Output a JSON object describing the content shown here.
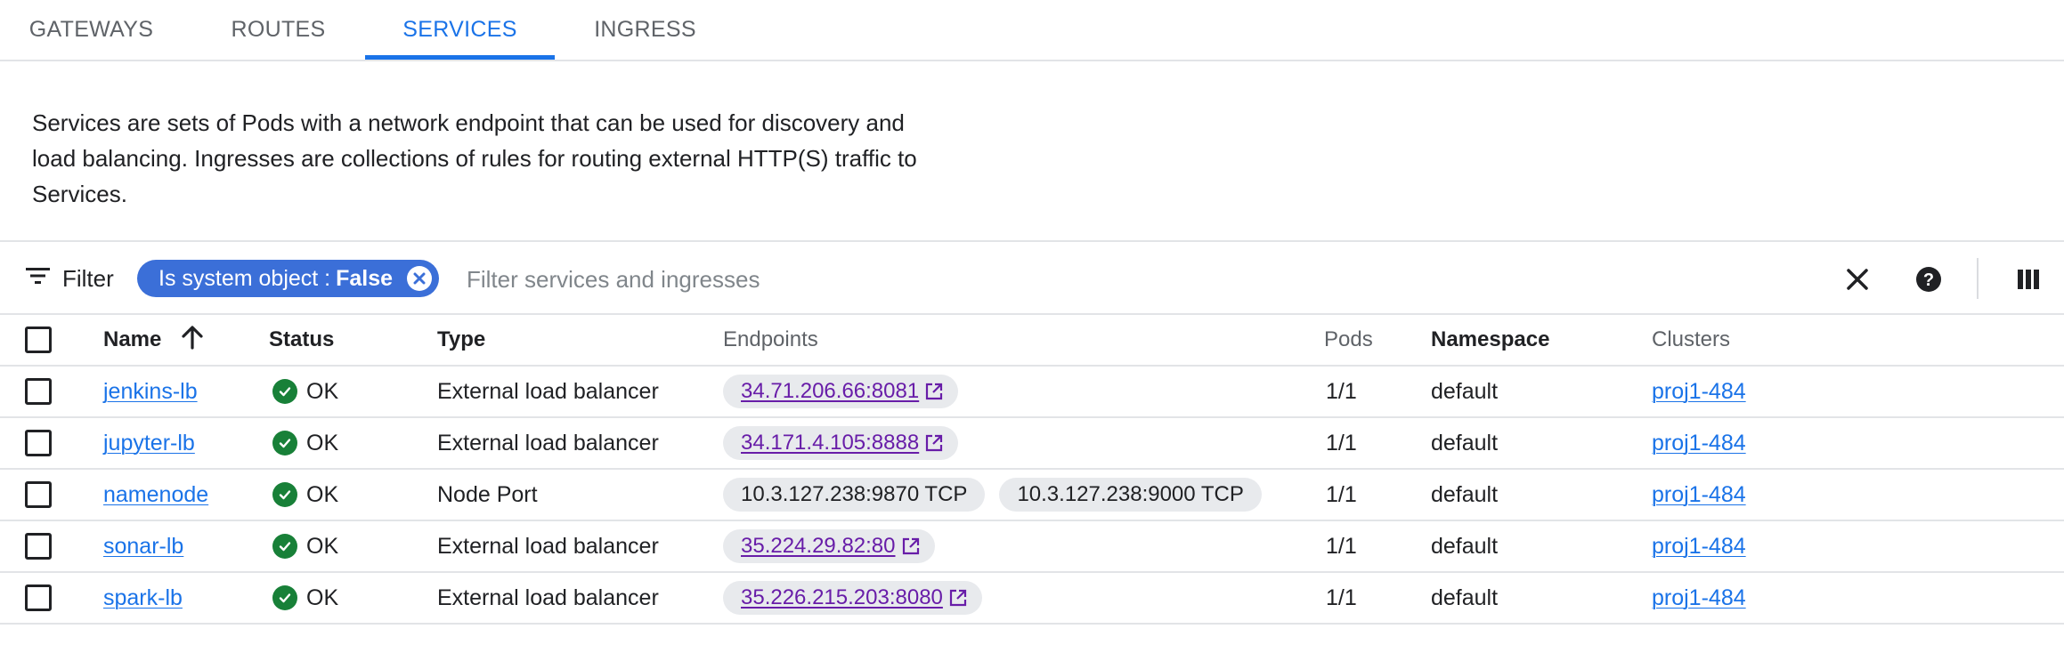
{
  "tabs": [
    {
      "label": "GATEWAYS",
      "active": false
    },
    {
      "label": "ROUTES",
      "active": false
    },
    {
      "label": "SERVICES",
      "active": true
    },
    {
      "label": "INGRESS",
      "active": false
    }
  ],
  "description": "Services are sets of Pods with a network endpoint that can be used for discovery and load balancing. Ingresses are collections of rules for routing external HTTP(S) traffic to Services.",
  "filter": {
    "button_label": "Filter",
    "chip": {
      "key": "Is system object :",
      "value": "False"
    },
    "placeholder": "Filter services and ingresses",
    "icons": [
      "filter-icon",
      "close-icon",
      "help-icon",
      "column-display-icon"
    ]
  },
  "table": {
    "columns": {
      "name": "Name",
      "status": "Status",
      "type": "Type",
      "endpoints": "Endpoints",
      "pods": "Pods",
      "namespace": "Namespace",
      "clusters": "Clusters"
    },
    "sort": {
      "column": "Name",
      "direction": "ascending"
    },
    "rows": [
      {
        "name": "jenkins-lb",
        "status": "OK",
        "type": "External load balancer",
        "endpoints": [
          {
            "text": "34.71.206.66:8081",
            "link": true
          }
        ],
        "pods": "1/1",
        "namespace": "default",
        "cluster": "proj1-484"
      },
      {
        "name": "jupyter-lb",
        "status": "OK",
        "type": "External load balancer",
        "endpoints": [
          {
            "text": "34.171.4.105:8888",
            "link": true
          }
        ],
        "pods": "1/1",
        "namespace": "default",
        "cluster": "proj1-484"
      },
      {
        "name": "namenode",
        "status": "OK",
        "type": "Node Port",
        "endpoints": [
          {
            "text": "10.3.127.238:9870 TCP",
            "link": false
          },
          {
            "text": "10.3.127.238:9000 TCP",
            "link": false
          }
        ],
        "pods": "1/1",
        "namespace": "default",
        "cluster": "proj1-484"
      },
      {
        "name": "sonar-lb",
        "status": "OK",
        "type": "External load balancer",
        "endpoints": [
          {
            "text": "35.224.29.82:80",
            "link": true
          }
        ],
        "pods": "1/1",
        "namespace": "default",
        "cluster": "proj1-484"
      },
      {
        "name": "spark-lb",
        "status": "OK",
        "type": "External load balancer",
        "endpoints": [
          {
            "text": "35.226.215.203:8080",
            "link": true
          }
        ],
        "pods": "1/1",
        "namespace": "default",
        "cluster": "proj1-484"
      }
    ]
  },
  "colors": {
    "accent": "#1a73e8",
    "chip": "#3b6fd8",
    "ok": "#188038",
    "visited_link": "#681da8"
  }
}
